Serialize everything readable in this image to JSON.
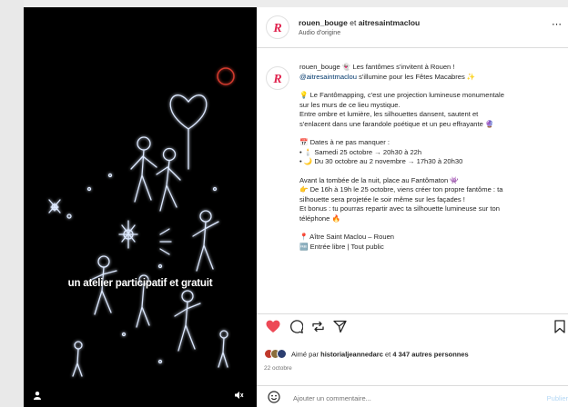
{
  "video": {
    "caption": "un atelier participatif et gratuit"
  },
  "post_header": {
    "author": "rouen_bouge",
    "connector": "et",
    "collaborator": "aitresaintmaclou",
    "audio": "Audio d'origine"
  },
  "caption": {
    "author": "rouen_bouge",
    "intro": "👻 Les fantômes s'invitent à Rouen !",
    "mention": "@aitresaintmaclou",
    "intro2": "s'illumine pour les Fêtes Macabres ✨",
    "p1_l1": "💡 Le Fantômapping, c'est une projection lumineuse monumentale",
    "p1_l2": "sur les murs de ce lieu mystique.",
    "p1_l3": "Entre ombre et lumière, les silhouettes dansent, sautent et",
    "p1_l4": "s'enlacent dans une farandole poétique et un peu effrayante 🔮",
    "dates_title": "📅 Dates à ne pas manquer :",
    "date1": "• 🕯️ Samedi 25 octobre → 20h30 à 22h",
    "date2": "• 🌙 Du 30 octobre au 2 novembre → 17h30 à 20h30",
    "p3_l1": "Avant la tombée de la nuit, place au Fantômaton 👾",
    "p3_l2": "👉 De 16h à 19h le 25 octobre, viens créer ton propre fantôme : ta",
    "p3_l3": "silhouette sera projetée le soir même sur les façades !",
    "p3_l4": "Et bonus : tu pourras repartir avec ta silhouette lumineuse sur ton",
    "p3_l5": "téléphone 🔥",
    "place": "📍 Aître Saint Maclou – Rouen",
    "entry": "🆓 Entrée libre | Tout public"
  },
  "likes": {
    "prefix": "Aimé par",
    "user": "historialjeannedarc",
    "connector": "et",
    "count": "4 347 autres personnes"
  },
  "date": "22 octobre",
  "comment": {
    "placeholder": "Ajouter un commentaire...",
    "publish": "Publier"
  },
  "icons": [
    "heart-icon",
    "comment-icon",
    "share-icon",
    "send-icon",
    "bookmark-icon",
    "emoji-icon",
    "more-icon",
    "mute-icon",
    "user-icon"
  ],
  "colors": {
    "like": "#ed4956",
    "mention": "#00376b",
    "publish": "#b3d7f5"
  }
}
